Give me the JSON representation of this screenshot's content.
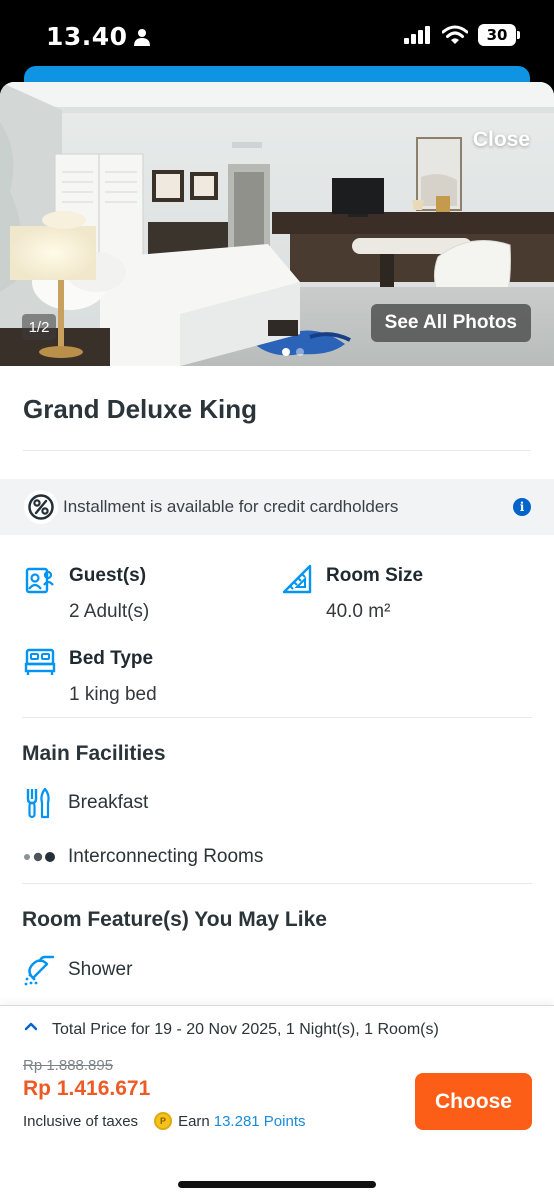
{
  "status_bar": {
    "time": "13.40",
    "battery": "30"
  },
  "photo": {
    "close_label": "Close",
    "counter": "1/2",
    "see_all_label": "See All Photos",
    "active_dot": 1,
    "dot_count": 2
  },
  "room": {
    "title": "Grand Deluxe King"
  },
  "installment": {
    "text": "Installment is available for credit cardholders",
    "info_glyph": "i"
  },
  "specs": {
    "guests_label": "Guest(s)",
    "guests_value": "2 Adult(s)",
    "room_size_label": "Room Size",
    "room_size_value": "40.0 m²",
    "bed_type_label": "Bed Type",
    "bed_type_value": "1 king bed"
  },
  "main_facilities": {
    "title": "Main Facilities",
    "items": [
      {
        "label": "Breakfast",
        "icon": "cutlery-icon"
      },
      {
        "label": "Interconnecting Rooms",
        "icon": "more-dots-icon"
      }
    ]
  },
  "room_features": {
    "title": "Room Feature(s) You May Like",
    "items": [
      {
        "label": "Shower",
        "icon": "shower-icon"
      }
    ]
  },
  "booking": {
    "total_text": "Total Price for 19 - 20 Nov 2025, 1 Night(s), 1 Room(s)",
    "old_price": "Rp 1.888.895",
    "new_price": "Rp 1.416.671",
    "tax_text": "Inclusive of taxes",
    "earn_label": "Earn",
    "points": "13.281 Points",
    "choose_label": "Choose"
  },
  "colors": {
    "accent_blue": "#0e94e3",
    "icon_blue": "#0194f3",
    "price_orange": "#ee5a24",
    "button_orange": "#fd5e17"
  }
}
